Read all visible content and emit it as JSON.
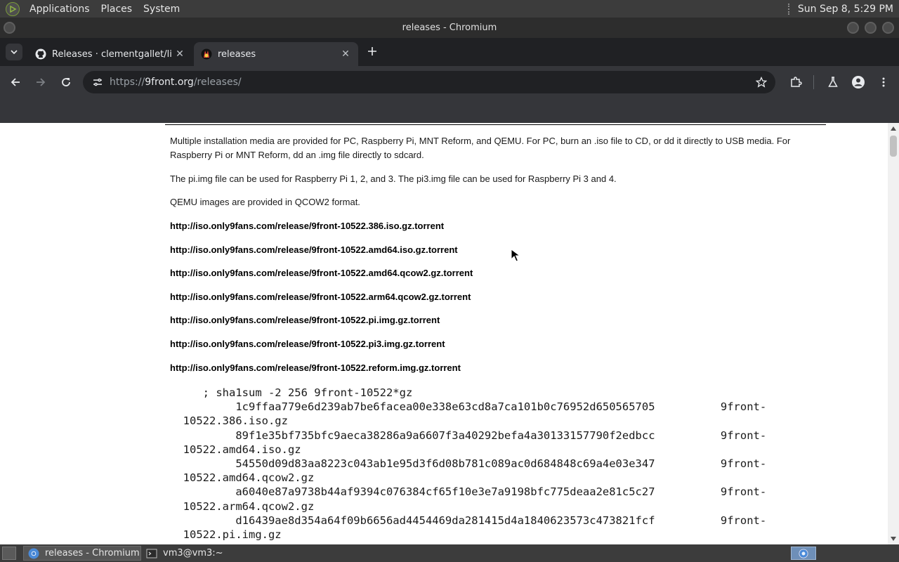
{
  "panel": {
    "menus": [
      "Applications",
      "Places",
      "System"
    ],
    "clock": "Sun Sep  8,  5:29 PM"
  },
  "window": {
    "title": "releases - Chromium"
  },
  "tabs": [
    {
      "title": "Releases · clementgallet/libT",
      "icon": "github-icon",
      "active": false
    },
    {
      "title": "releases",
      "icon": "9front-bunny-icon",
      "active": true
    }
  ],
  "omnibox": {
    "scheme": "https://",
    "host": "9front.org",
    "path": "/releases/"
  },
  "page": {
    "intro": "Multiple installation media are provided for PC, Raspberry Pi, MNT Reform, and QEMU. For PC, burn an .iso file to CD, or dd it directly to USB media. For Raspberry Pi or MNT Reform, dd an .img file directly to sdcard.",
    "pi_note": "The pi.img file can be used for Raspberry Pi 1, 2, and 3. The pi3.img file can be used for Raspberry Pi 3 and 4.",
    "qemu_note": "QEMU images are provided in QCOW2 format.",
    "links": [
      "http://iso.only9fans.com/release/9front-10522.386.iso.gz.torrent",
      "http://iso.only9fans.com/release/9front-10522.amd64.iso.gz.torrent",
      "http://iso.only9fans.com/release/9front-10522.amd64.qcow2.gz.torrent",
      "http://iso.only9fans.com/release/9front-10522.arm64.qcow2.gz.torrent",
      "http://iso.only9fans.com/release/9front-10522.pi.img.gz.torrent",
      "http://iso.only9fans.com/release/9front-10522.pi3.img.gz.torrent",
      "http://iso.only9fans.com/release/9front-10522.reform.img.gz.torrent"
    ],
    "checksums": "     ; sha1sum -2 256 9front-10522*gz\n          1c9ffaa779e6d239ab7be6facea00e338e63cd8a7ca101b0c76952d650565705          9front-\n  10522.386.iso.gz\n          89f1e35bf735bfc9aeca38286a9a6607f3a40292befa4a30133157790f2edbcc          9front-\n  10522.amd64.iso.gz\n          54550d09d83aa8223c043ab1e95d3f6d08b781c089ac0d684848c69a4e03e347          9front-\n  10522.amd64.qcow2.gz\n          a6040e87a9738b44af9394c076384cf65f10e3e7a9198bfc775deaa2e81c5c27          9front-\n  10522.arm64.qcow2.gz\n          d16439ae8d354a64f09b6656ad4454469da281415d4a1840623573c473821fcf          9front-\n  10522.pi.img.gz"
  },
  "taskbar": {
    "tasks": [
      {
        "label": "releases - Chromium",
        "icon": "chromium-icon",
        "active": true
      },
      {
        "label": "vm3@vm3:~",
        "icon": "terminal-icon",
        "active": false
      }
    ]
  }
}
